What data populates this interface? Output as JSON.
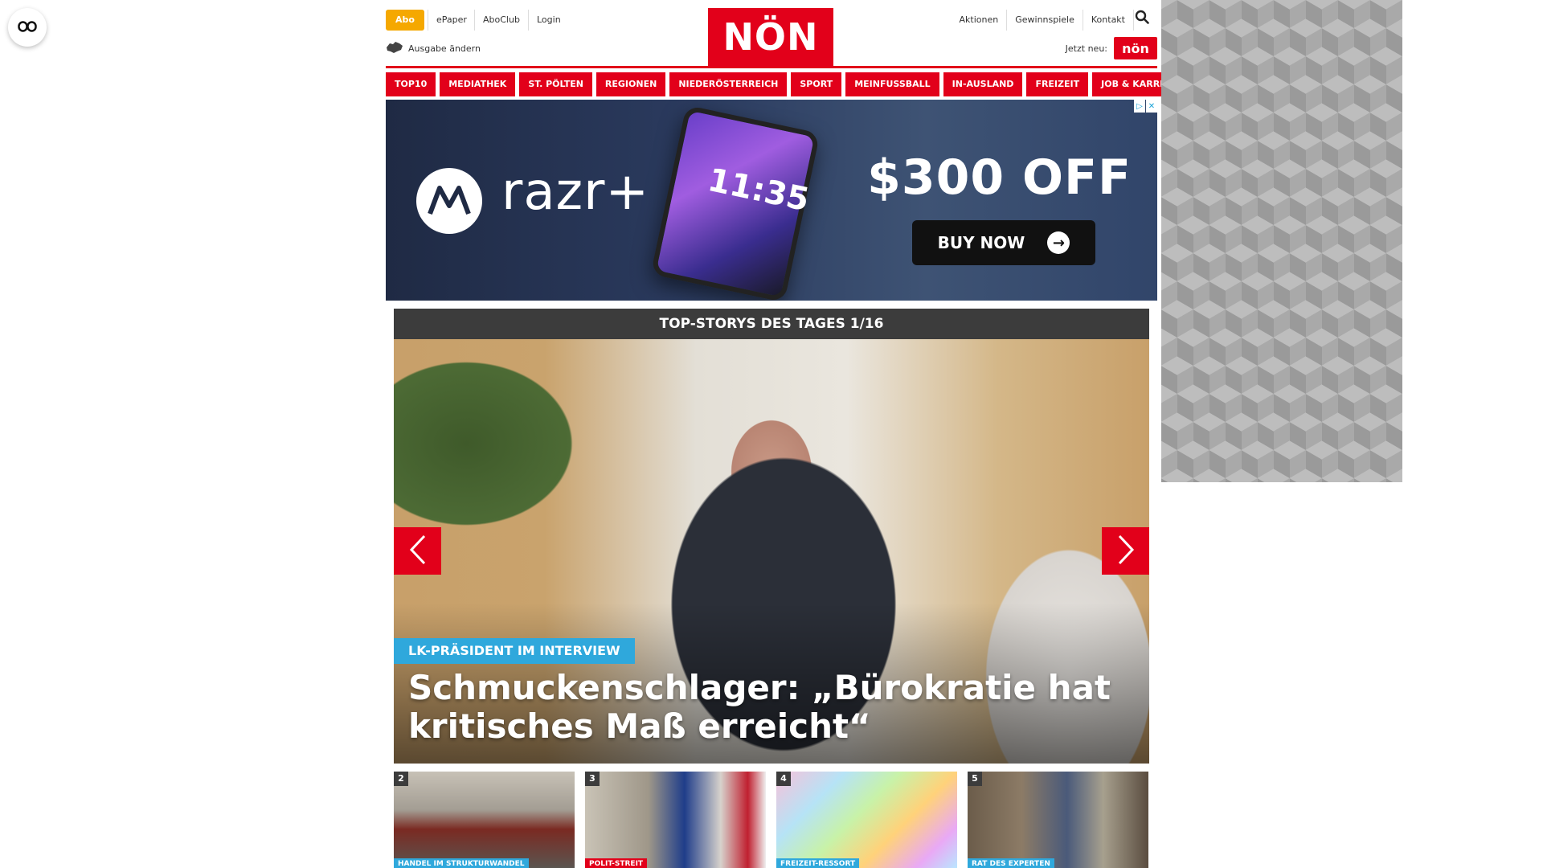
{
  "header": {
    "abo_label": "Abo",
    "links_left": [
      "ePaper",
      "AboClub",
      "Login"
    ],
    "ausgabe_label": "Ausgabe ändern",
    "logo_text": "NÖN",
    "links_right": [
      "Aktionen",
      "Gewinnspiele",
      "Kontakt"
    ],
    "jetzt_label": "Jetzt neu:",
    "jetzt_badge": "nön",
    "brand_color": "#e2001a",
    "abo_color": "#f5a800"
  },
  "nav": {
    "items": [
      "TOP10",
      "MEDIATHEK",
      "ST. PÖLTEN",
      "REGIONEN",
      "NIEDERÖSTERREICH",
      "SPORT",
      "MEINFUSSBALL",
      "IN-AUSLAND",
      "FREIZEIT",
      "JOB & KARRIERE"
    ]
  },
  "ad": {
    "brand": "razr+",
    "phone_time": "11:35",
    "offer": "$300 OFF",
    "cta": "BUY NOW"
  },
  "stories": {
    "header": "TOP-STORYS DES TAGES 1/16",
    "hero_tag": "LK-PRÄSIDENT IM INTERVIEW",
    "hero_title": "Schmuckenschlager: „Bürokratie hat kritisches Maß erreicht“",
    "hero_tag_color": "#2fa8dc",
    "thumbs": [
      {
        "num": "2",
        "tag": "HANDEL IM STRUKTURWANDEL",
        "tag_color": "#2fa8dc"
      },
      {
        "num": "3",
        "tag": "POLIT-STREIT",
        "tag_color": "#e2001a"
      },
      {
        "num": "4",
        "tag": "FREIZEIT-RESSORT",
        "tag_color": "#2fa8dc"
      },
      {
        "num": "5",
        "tag": "RAT DES EXPERTEN",
        "tag_color": "#2fa8dc"
      }
    ]
  },
  "icons": [
    "readmode-icon",
    "search-icon",
    "map-austria-icon",
    "chevron-left-icon",
    "chevron-right-icon",
    "motorola-logo-icon",
    "arrow-right-icon",
    "adchoices-icon",
    "close-icon"
  ]
}
